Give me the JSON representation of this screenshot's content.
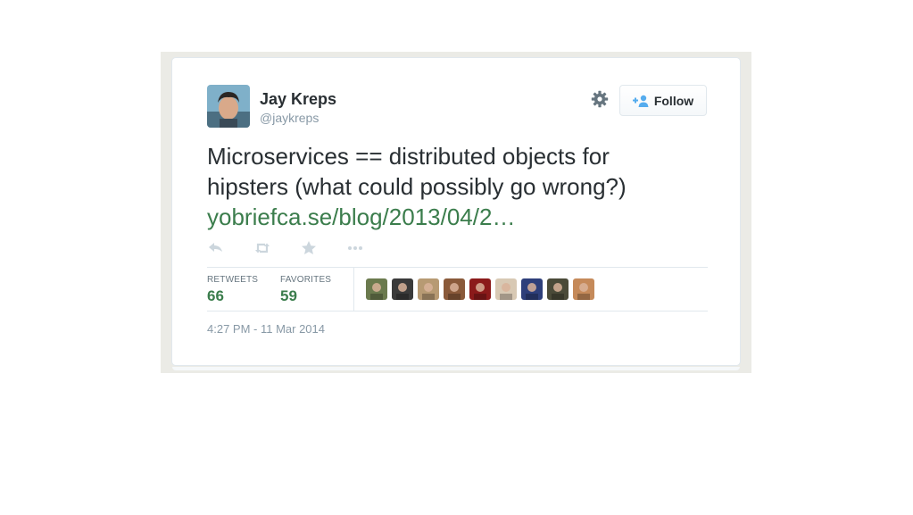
{
  "tweet": {
    "author_name": "Jay Kreps",
    "author_handle": "@jaykreps",
    "text": "Microservices == distributed objects for hipsters (what could possibly go wrong?)",
    "link_text": "yobriefca.se/blog/2013/04/2…",
    "timestamp": "4:27 PM - 11 Mar 2014"
  },
  "follow_button": {
    "label": "Follow",
    "icon": "add-person-icon"
  },
  "header_icons": [
    "gear-icon"
  ],
  "actions": [
    "reply-icon",
    "retweet-icon",
    "favorite-star-icon",
    "more-dots-icon"
  ],
  "stats": {
    "retweets_label": "RETWEETS",
    "retweets_value": "66",
    "favorites_label": "FAVORITES",
    "favorites_value": "59"
  },
  "favoriters": [
    {
      "name": "favoriter-avatar-1",
      "color": "#6b7a4e"
    },
    {
      "name": "favoriter-avatar-2",
      "color": "#3a3a3a"
    },
    {
      "name": "favoriter-avatar-3",
      "color": "#b79a73"
    },
    {
      "name": "favoriter-avatar-4",
      "color": "#8a5a3a"
    },
    {
      "name": "favoriter-avatar-5",
      "color": "#8b1a1a"
    },
    {
      "name": "favoriter-avatar-6",
      "color": "#d8c9b4"
    },
    {
      "name": "favoriter-avatar-7",
      "color": "#2e3f7a"
    },
    {
      "name": "favoriter-avatar-8",
      "color": "#4a4a38"
    },
    {
      "name": "favoriter-avatar-9",
      "color": "#c58a5a"
    }
  ],
  "colors": {
    "link": "#3b7d4c",
    "text": "#292f33",
    "muted": "#8899a6",
    "follow_icon": "#55acee"
  }
}
